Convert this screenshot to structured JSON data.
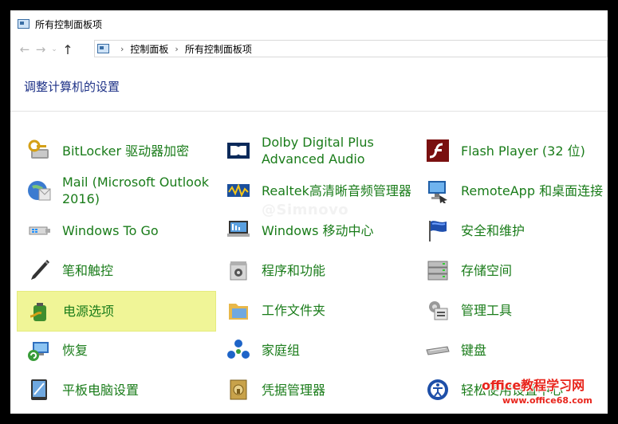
{
  "window": {
    "title": "所有控制面板项"
  },
  "nav": {
    "back": "←",
    "forward": "→",
    "recent": "⌄",
    "up": "↑",
    "separator": "›",
    "breadcrumbs": [
      "控制面板",
      "所有控制面板项"
    ]
  },
  "heading": "调整计算机的设置",
  "items": [
    {
      "label": "BitLocker 驱动器加密",
      "icon": "bitlocker-icon"
    },
    {
      "label": "Dolby Digital Plus Advanced Audio",
      "icon": "dolby-icon"
    },
    {
      "label": "Flash Player (32 位)",
      "icon": "flash-player-icon"
    },
    {
      "label": "Mail (Microsoft Outlook 2016)",
      "icon": "mail-icon"
    },
    {
      "label": "Realtek高清晰音频管理器",
      "icon": "realtek-audio-icon"
    },
    {
      "label": "RemoteApp 和桌面连接",
      "icon": "remoteapp-icon"
    },
    {
      "label": "Windows To Go",
      "icon": "windows-to-go-icon"
    },
    {
      "label": "Windows 移动中心",
      "icon": "mobility-center-icon"
    },
    {
      "label": "安全和维护",
      "icon": "security-flag-icon"
    },
    {
      "label": "笔和触控",
      "icon": "pen-icon"
    },
    {
      "label": "程序和功能",
      "icon": "programs-icon"
    },
    {
      "label": "存储空间",
      "icon": "storage-icon"
    },
    {
      "label": "电源选项",
      "icon": "power-options-icon",
      "highlighted": true
    },
    {
      "label": "工作文件夹",
      "icon": "work-folders-icon"
    },
    {
      "label": "管理工具",
      "icon": "admin-tools-icon"
    },
    {
      "label": "恢复",
      "icon": "recovery-icon"
    },
    {
      "label": "家庭组",
      "icon": "homegroup-icon"
    },
    {
      "label": "键盘",
      "icon": "keyboard-icon"
    },
    {
      "label": "平板电脑设置",
      "icon": "tablet-icon"
    },
    {
      "label": "凭据管理器",
      "icon": "credential-icon"
    },
    {
      "label": "轻松使用设置中心",
      "icon": "ease-of-access-icon"
    }
  ],
  "watermark": "@Simnovo",
  "brand": {
    "line1": "office教程学习网",
    "line2": "www.office68.com"
  },
  "colors": {
    "link": "#1a7c1a",
    "heading": "#1e3287",
    "highlight": "#f0f597"
  }
}
